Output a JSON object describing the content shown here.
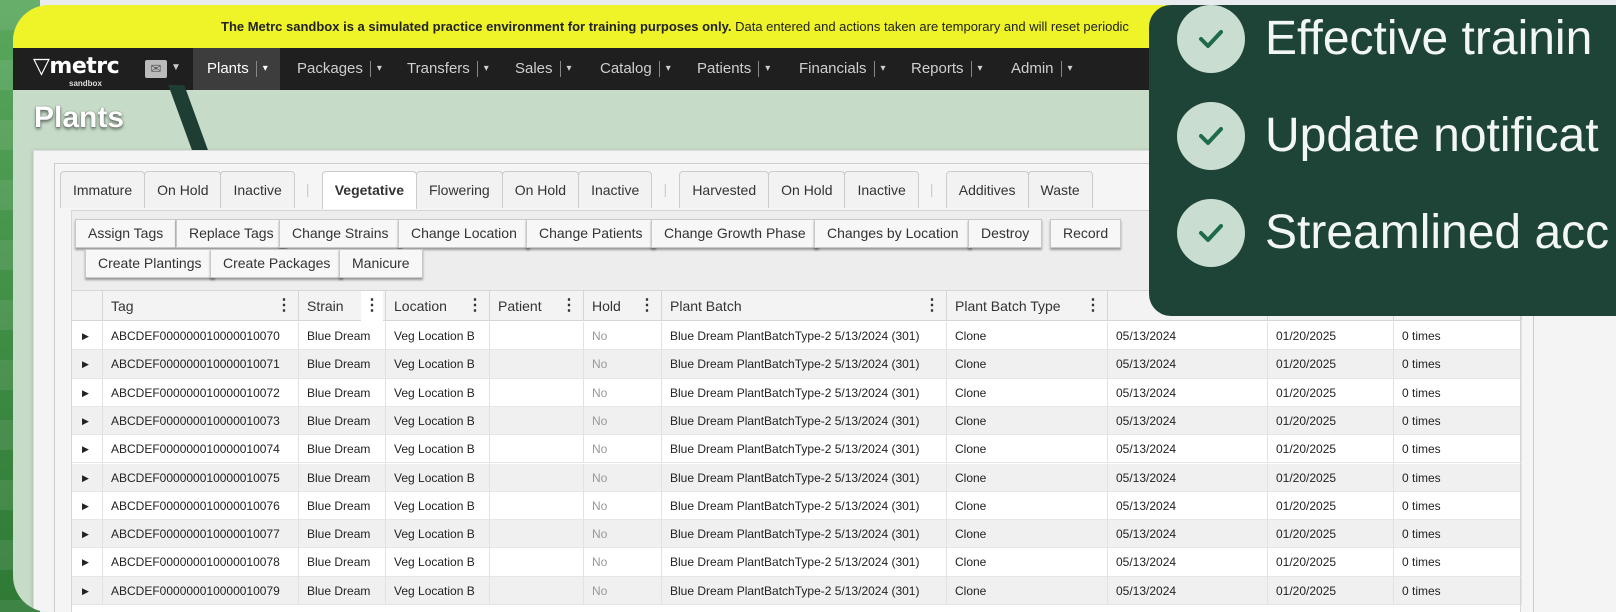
{
  "banner": {
    "bold": "The Metrc sandbox is a simulated practice environment for training purposes only.",
    "rest": "Data entered and actions taken are temporary and will reset periodic"
  },
  "logo": {
    "word": "metrc",
    "sub": "sandbox"
  },
  "nav": [
    {
      "label": "Plants",
      "active": true
    },
    {
      "label": "Packages"
    },
    {
      "label": "Transfers"
    },
    {
      "label": "Sales"
    },
    {
      "label": "Catalog"
    },
    {
      "label": "Patients"
    },
    {
      "label": "Financials"
    },
    {
      "label": "Reports"
    },
    {
      "label": "Admin"
    }
  ],
  "page_title": "Plants",
  "tabs": {
    "immature": [
      "Immature",
      "On Hold",
      "Inactive"
    ],
    "vegetative": [
      "Vegetative",
      "Flowering",
      "On Hold",
      "Inactive"
    ],
    "harvested": [
      "Harvested",
      "On Hold",
      "Inactive"
    ],
    "other": [
      "Additives",
      "Waste"
    ],
    "active": "Vegetative",
    "separator": "|"
  },
  "actions": {
    "row1": [
      "Assign Tags",
      "Replace Tags",
      "Change Strains",
      "Change Location",
      "Change Patients",
      "Change Growth Phase",
      "Changes by Location",
      "Destroy",
      "Record"
    ],
    "row2": [
      "Create Plantings",
      "Create Packages",
      "Manicure"
    ]
  },
  "columns": [
    "Tag",
    "Strain",
    "Location",
    "Patient",
    "Hold",
    "Plant Batch",
    "Plant Batch Type"
  ],
  "rows": [
    {
      "tag": "ABCDEF000000010000010070",
      "strain": "Blue Dream",
      "location": "Veg Location B",
      "patient": "",
      "hold": "No",
      "batch": "Blue Dream PlantBatchType-2 5/13/2024 (301)",
      "type": "Clone",
      "date1": "05/13/2024",
      "date2": "01/20/2025",
      "times": "0 times"
    },
    {
      "tag": "ABCDEF000000010000010071",
      "strain": "Blue Dream",
      "location": "Veg Location B",
      "patient": "",
      "hold": "No",
      "batch": "Blue Dream PlantBatchType-2 5/13/2024 (301)",
      "type": "Clone",
      "date1": "05/13/2024",
      "date2": "01/20/2025",
      "times": "0 times"
    },
    {
      "tag": "ABCDEF000000010000010072",
      "strain": "Blue Dream",
      "location": "Veg Location B",
      "patient": "",
      "hold": "No",
      "batch": "Blue Dream PlantBatchType-2 5/13/2024 (301)",
      "type": "Clone",
      "date1": "05/13/2024",
      "date2": "01/20/2025",
      "times": "0 times"
    },
    {
      "tag": "ABCDEF000000010000010073",
      "strain": "Blue Dream",
      "location": "Veg Location B",
      "patient": "",
      "hold": "No",
      "batch": "Blue Dream PlantBatchType-2 5/13/2024 (301)",
      "type": "Clone",
      "date1": "05/13/2024",
      "date2": "01/20/2025",
      "times": "0 times"
    },
    {
      "tag": "ABCDEF000000010000010074",
      "strain": "Blue Dream",
      "location": "Veg Location B",
      "patient": "",
      "hold": "No",
      "batch": "Blue Dream PlantBatchType-2 5/13/2024 (301)",
      "type": "Clone",
      "date1": "05/13/2024",
      "date2": "01/20/2025",
      "times": "0 times"
    },
    {
      "tag": "ABCDEF000000010000010075",
      "strain": "Blue Dream",
      "location": "Veg Location B",
      "patient": "",
      "hold": "No",
      "batch": "Blue Dream PlantBatchType-2 5/13/2024 (301)",
      "type": "Clone",
      "date1": "05/13/2024",
      "date2": "01/20/2025",
      "times": "0 times"
    },
    {
      "tag": "ABCDEF000000010000010076",
      "strain": "Blue Dream",
      "location": "Veg Location B",
      "patient": "",
      "hold": "No",
      "batch": "Blue Dream PlantBatchType-2 5/13/2024 (301)",
      "type": "Clone",
      "date1": "05/13/2024",
      "date2": "01/20/2025",
      "times": "0 times"
    },
    {
      "tag": "ABCDEF000000010000010077",
      "strain": "Blue Dream",
      "location": "Veg Location B",
      "patient": "",
      "hold": "No",
      "batch": "Blue Dream PlantBatchType-2 5/13/2024 (301)",
      "type": "Clone",
      "date1": "05/13/2024",
      "date2": "01/20/2025",
      "times": "0 times"
    },
    {
      "tag": "ABCDEF000000010000010078",
      "strain": "Blue Dream",
      "location": "Veg Location B",
      "patient": "",
      "hold": "No",
      "batch": "Blue Dream PlantBatchType-2 5/13/2024 (301)",
      "type": "Clone",
      "date1": "05/13/2024",
      "date2": "01/20/2025",
      "times": "0 times"
    },
    {
      "tag": "ABCDEF000000010000010079",
      "strain": "Blue Dream",
      "location": "Veg Location B",
      "patient": "",
      "hold": "No",
      "batch": "Blue Dream PlantBatchType-2 5/13/2024 (301)",
      "type": "Clone",
      "date1": "05/13/2024",
      "date2": "01/20/2025",
      "times": "0 times"
    }
  ],
  "overlay": {
    "items": [
      "Effective trainin",
      "Update notificat",
      "Streamlined acc"
    ],
    "icon": "check-icon"
  },
  "colors": {
    "banner": "#eef428",
    "navbar": "#1f1f1f",
    "overlay": "#1e4437",
    "page_bg": "#c6dcc8"
  }
}
